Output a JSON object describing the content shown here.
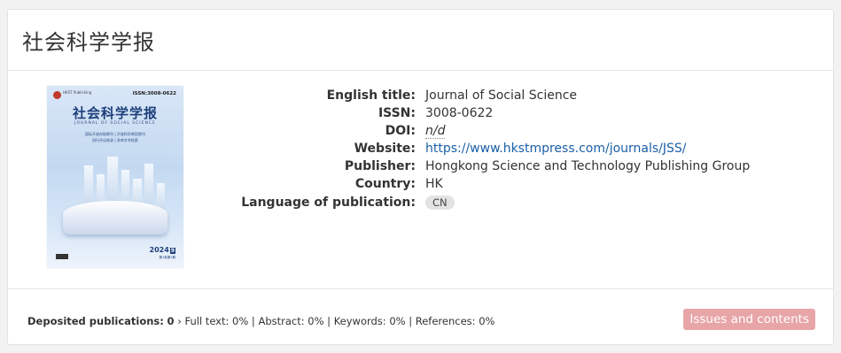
{
  "page_title": "社会科学学报",
  "cover": {
    "publisher_logo_text": "HKST Publishing",
    "issn_tag": "ISSN:3008-0622",
    "title_cn": "社会科学学报",
    "subtitle_en": "JOURNAL OF SOCIAL SCIENCE",
    "tag_line_1": "国际开放存取期刊 | 开放科学典型期刊",
    "tag_line_2": "同行评议收录 | 多库学术检索",
    "year": "2024",
    "issue": "9",
    "volume": "第1卷第1期"
  },
  "fields": [
    {
      "label": "English title:",
      "value": "Journal of Social Science",
      "type": "text"
    },
    {
      "label": "ISSN:",
      "value": "3008-0622",
      "type": "text"
    },
    {
      "label": "DOI:",
      "value": "n/d",
      "type": "italic"
    },
    {
      "label": "Website:",
      "value": "https://www.hkstmpress.com/journals/JSS/",
      "type": "link"
    },
    {
      "label": "Publisher:",
      "value": "Hongkong Science and Technology Publishing Group",
      "type": "text"
    },
    {
      "label": "Country:",
      "value": "HK",
      "type": "text"
    },
    {
      "label": "Language of publication:",
      "value": "CN",
      "type": "badge"
    }
  ],
  "footer": {
    "deposited_label": "Deposited publications:",
    "deposited_count": "0",
    "rest": "Full text: 0% | Abstract: 0% | Keywords: 0% | References: 0%",
    "issues_button": "Issues and contents"
  },
  "colors": {
    "link": "#1a5fa8",
    "button_bg": "#e8a5a8",
    "cover_title": "#1d3f7a"
  }
}
